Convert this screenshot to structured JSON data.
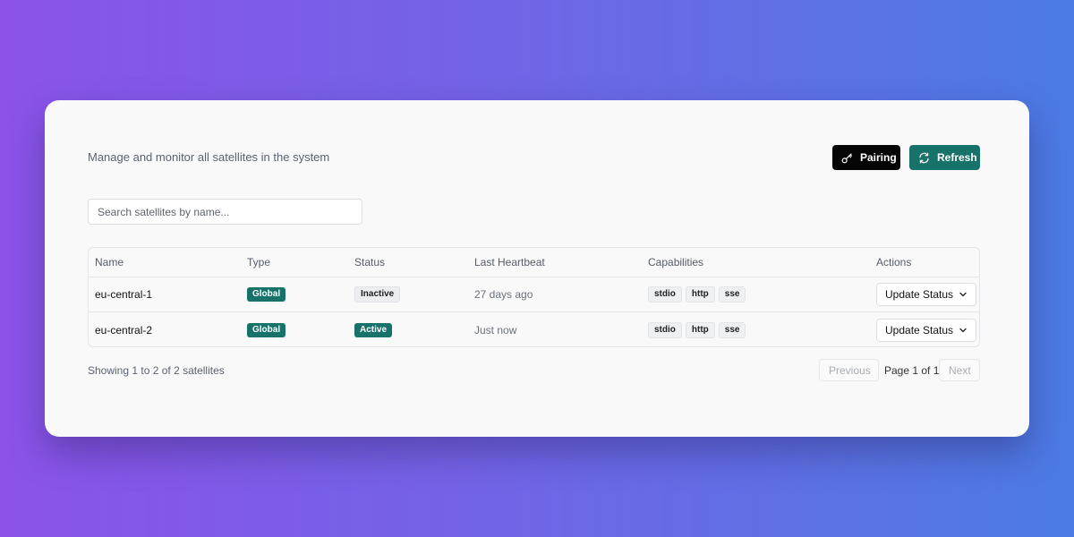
{
  "header": {
    "subtitle": "Manage and monitor all satellites in the system",
    "pairing_label": "Pairing",
    "refresh_label": "Refresh"
  },
  "search": {
    "placeholder": "Search satellites by name...",
    "value": ""
  },
  "table": {
    "columns": [
      "Name",
      "Type",
      "Status",
      "Last Heartbeat",
      "Capabilities",
      "Actions"
    ],
    "rows": [
      {
        "name": "eu-central-1",
        "type": "Global",
        "status": "Inactive",
        "last_heartbeat": "27 days ago",
        "capabilities": [
          "stdio",
          "http",
          "sse"
        ],
        "action_label": "Update Status"
      },
      {
        "name": "eu-central-2",
        "type": "Global",
        "status": "Active",
        "last_heartbeat": "Just now",
        "capabilities": [
          "stdio",
          "http",
          "sse"
        ],
        "action_label": "Update Status"
      }
    ]
  },
  "pagination": {
    "summary": "Showing 1 to 2 of 2 satellites",
    "previous_label": "Previous",
    "page_label": "Page 1 of 1",
    "next_label": "Next"
  },
  "icons": {
    "pairing": "key-icon",
    "refresh": "refresh-icon",
    "dropdown": "chevron-down-icon"
  },
  "colors": {
    "accent": "#17736a",
    "dark_button": "#050505",
    "card_background": "#f9f9f9"
  }
}
